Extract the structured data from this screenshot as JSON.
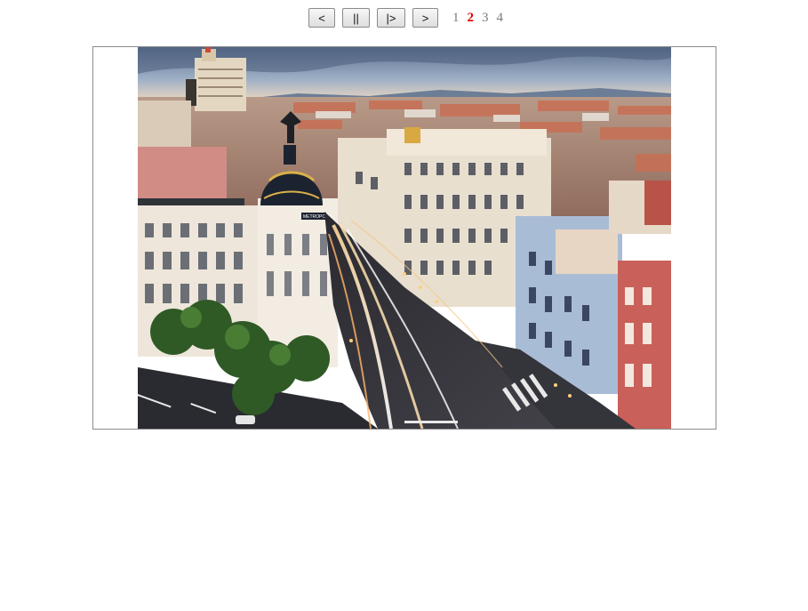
{
  "slideshow": {
    "controls": {
      "prev_label": "<",
      "pause_label": "||",
      "play_label": "|>",
      "next_label": ">"
    },
    "pages": [
      "1",
      "2",
      "3",
      "4"
    ],
    "current_page": "2",
    "image": {
      "sign_text": "METROPOLIS"
    }
  }
}
